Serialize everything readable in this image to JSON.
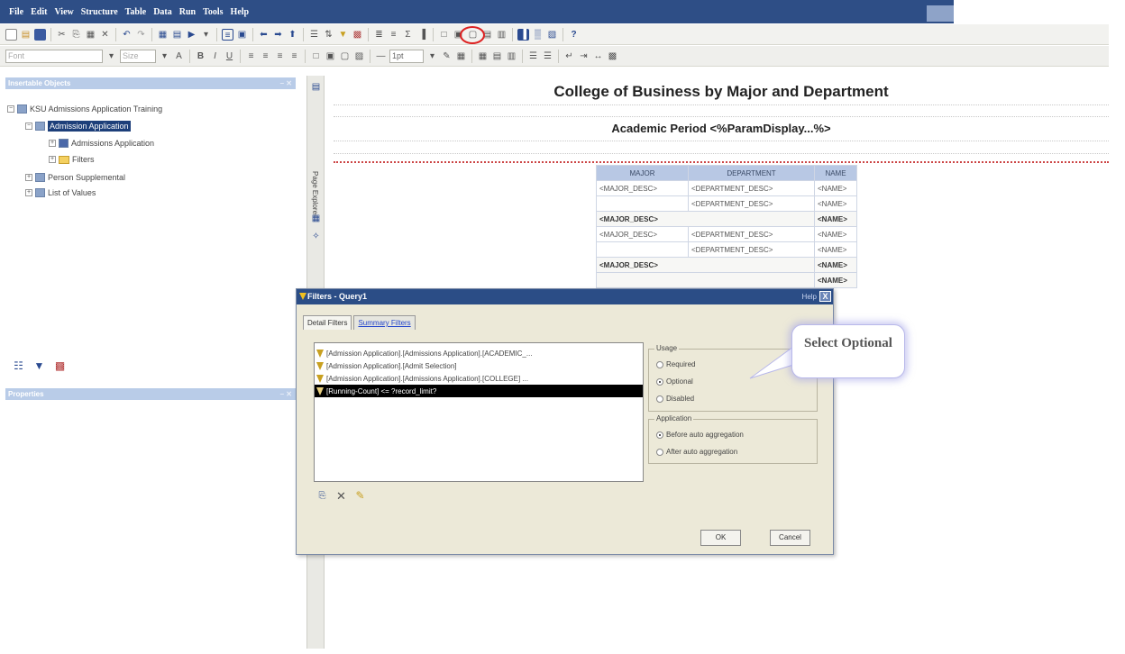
{
  "menu": [
    "File",
    "Edit",
    "View",
    "Structure",
    "Table",
    "Data",
    "Run",
    "Tools",
    "Help"
  ],
  "toolbar2": {
    "font_placeholder": "Font",
    "size_placeholder": "Size",
    "size_value": "1pt"
  },
  "panels": {
    "insertable_objects": "Insertable Objects",
    "properties": "Properties"
  },
  "tree": {
    "root": "KSU Admissions Application Training",
    "items": [
      "Admission Application",
      "Admissions Application",
      "Filters",
      "Person Supplemental",
      "List of Values"
    ]
  },
  "side_tab": "Page Explorer",
  "report": {
    "title": "College of Business by Major and Department",
    "subtitle": "Academic Period  <%ParamDisplay...%>",
    "headers": [
      "MAJOR",
      "DEPARTMENT",
      "NAME"
    ],
    "rows": [
      {
        "major": "<MAJOR_DESC>",
        "dept": "<DEPARTMENT_DESC>",
        "name": "<NAME>"
      },
      {
        "major": "",
        "dept": "<DEPARTMENT_DESC>",
        "name": "<NAME>"
      },
      {
        "summary": "<MAJOR_DESC>",
        "name": "<NAME>"
      },
      {
        "major": "<MAJOR_DESC>",
        "dept": "<DEPARTMENT_DESC>",
        "name": "<NAME>"
      },
      {
        "major": "",
        "dept": "<DEPARTMENT_DESC>",
        "name": "<NAME>"
      },
      {
        "summary": "<MAJOR_DESC>",
        "name": "<NAME>"
      },
      {
        "summary": "",
        "name": "<NAME>"
      }
    ]
  },
  "dialog": {
    "title": "Filters - Query1",
    "help": "Help",
    "close": "X",
    "tabs": [
      "Detail Filters",
      "Summary Filters"
    ],
    "filters": [
      "[Admission Application].[Admissions Application].[ACADEMIC_...",
      "[Admission Application].[Admit Selection]",
      "[Admission Application].[Admissions Application].[COLLEGE] ...",
      "[Running-Count] <= ?record_limit?"
    ],
    "usage": {
      "label": "Usage",
      "options": [
        "Required",
        "Optional",
        "Disabled"
      ],
      "selected": "Optional"
    },
    "application": {
      "label": "Application",
      "options": [
        "Before auto aggregation",
        "After auto aggregation"
      ],
      "selected": "Before auto aggregation"
    },
    "ok": "OK",
    "cancel": "Cancel"
  },
  "callout": "Select Optional",
  "colors": {
    "menubar": "#2e4e86",
    "selection": "#1d3f7a",
    "highlight_circle": "#dd2222"
  }
}
